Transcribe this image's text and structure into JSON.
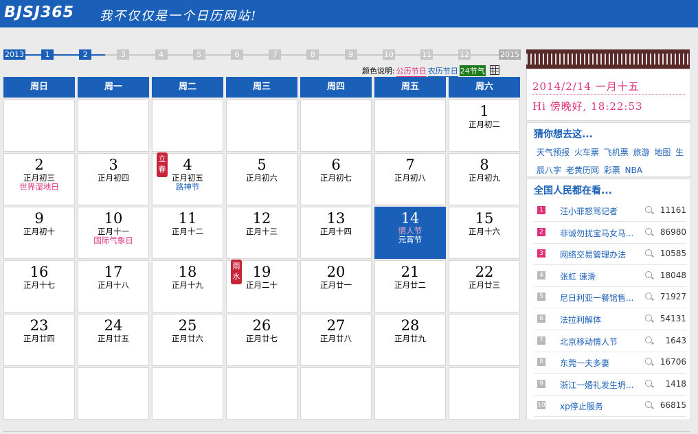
{
  "header": {
    "logo": "BJSJ365",
    "slogan": "我不仅仅是一个日历网站!"
  },
  "month_bar": {
    "prev_year": "2013",
    "next_year": "2015",
    "months": [
      "1",
      "2",
      "3",
      "4",
      "5",
      "6",
      "7",
      "8",
      "9",
      "10",
      "11",
      "12"
    ],
    "selected_month": "2"
  },
  "legend": {
    "label": "颜色说明:",
    "public": "公历节日",
    "lunar": "农历节日",
    "term": "24节气"
  },
  "calendar": {
    "weekdays": [
      "周日",
      "周一",
      "周二",
      "周三",
      "周四",
      "周五",
      "周六"
    ],
    "days": [
      {
        "n": "1",
        "lunar": "正月初二"
      },
      {
        "n": "2",
        "lunar": "正月初三",
        "fest": "世界湿地日",
        "fest_type": "pink"
      },
      {
        "n": "3",
        "lunar": "正月初四"
      },
      {
        "n": "4",
        "lunar": "正月初五",
        "fest": "路神节",
        "fest_type": "blue",
        "stamp": "立春"
      },
      {
        "n": "5",
        "lunar": "正月初六"
      },
      {
        "n": "6",
        "lunar": "正月初七"
      },
      {
        "n": "7",
        "lunar": "正月初八"
      },
      {
        "n": "8",
        "lunar": "正月初九"
      },
      {
        "n": "9",
        "lunar": "正月初十"
      },
      {
        "n": "10",
        "lunar": "正月十一",
        "fest": "国际气象日",
        "fest_type": "pink"
      },
      {
        "n": "11",
        "lunar": "正月十二"
      },
      {
        "n": "12",
        "lunar": "正月十三"
      },
      {
        "n": "13",
        "lunar": "正月十四"
      },
      {
        "n": "14",
        "lunar": "情人节",
        "fest": "元宵节",
        "fest_type": "blue",
        "today": true,
        "lunar_pink": true
      },
      {
        "n": "15",
        "lunar": "正月十六"
      },
      {
        "n": "16",
        "lunar": "正月十七"
      },
      {
        "n": "17",
        "lunar": "正月十八"
      },
      {
        "n": "18",
        "lunar": "正月十九"
      },
      {
        "n": "19",
        "lunar": "正月二十",
        "stamp": "雨水"
      },
      {
        "n": "20",
        "lunar": "正月廿一"
      },
      {
        "n": "21",
        "lunar": "正月廿二"
      },
      {
        "n": "22",
        "lunar": "正月廿三"
      },
      {
        "n": "23",
        "lunar": "正月廿四"
      },
      {
        "n": "24",
        "lunar": "正月廿五"
      },
      {
        "n": "25",
        "lunar": "正月廿六"
      },
      {
        "n": "26",
        "lunar": "正月廿七"
      },
      {
        "n": "27",
        "lunar": "正月廿八"
      },
      {
        "n": "28",
        "lunar": "正月廿九"
      }
    ]
  },
  "today_box": {
    "line1": "2014/2/14   一月十五",
    "line2": "Hi  傍晚好,  18:22:53"
  },
  "guess": {
    "title": "猜你想去这...",
    "links": [
      "天气预报",
      "火车票",
      "飞机票",
      "旅游",
      "地图",
      "生辰八字",
      "老黄历网",
      "彩票",
      "NBA"
    ]
  },
  "hot": {
    "title": "全国人民都在看...",
    "items": [
      {
        "rank": "1",
        "text": "汪小菲怒骂记者",
        "count": "11161"
      },
      {
        "rank": "2",
        "text": "非诚勿扰宝马女马...",
        "count": "86980"
      },
      {
        "rank": "3",
        "text": "网络交易管理办法",
        "count": "10585"
      },
      {
        "rank": "4",
        "text": "张虹 速滑",
        "count": "18048"
      },
      {
        "rank": "5",
        "text": "尼日利亚一餐馆售...",
        "count": "71927"
      },
      {
        "rank": "6",
        "text": "法拉利解体",
        "count": "54131"
      },
      {
        "rank": "7",
        "text": "北京移动情人节",
        "count": "1643"
      },
      {
        "rank": "8",
        "text": "东莞一夫多妻",
        "count": "16706"
      },
      {
        "rank": "9",
        "text": "浙江一婚礼发生坍...",
        "count": "1418"
      },
      {
        "rank": "10",
        "text": "xp停止服务",
        "count": "66815"
      }
    ]
  }
}
